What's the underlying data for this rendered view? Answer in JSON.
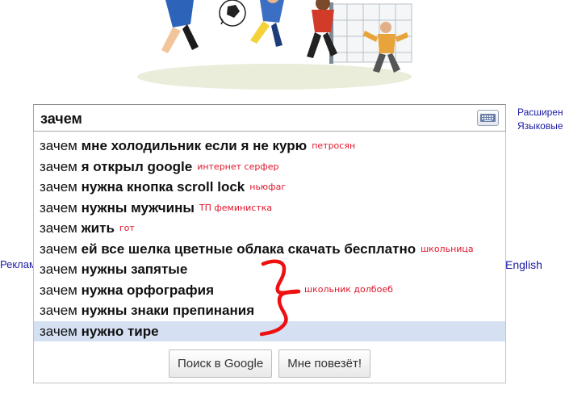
{
  "search": {
    "value": "зачем"
  },
  "suggestions": [
    {
      "prefix": "зачем",
      "completion": "мне холодильник если я не курю",
      "note": "петросян"
    },
    {
      "prefix": "зачем",
      "completion": "я открыл google",
      "note": "интернет серфер"
    },
    {
      "prefix": "зачем",
      "completion": "нужна кнопка scroll lock",
      "note": "ньюфаг"
    },
    {
      "prefix": "зачем",
      "completion": "нужны мужчины",
      "note": "ТП феминистка"
    },
    {
      "prefix": "зачем",
      "completion": "жить",
      "note": "гот"
    },
    {
      "prefix": "зачем",
      "completion": "ей все шелка цветные облака скачать бесплатно",
      "note": "школьница"
    },
    {
      "prefix": "зачем",
      "completion": "нужны запятые",
      "note": ""
    },
    {
      "prefix": "зачем",
      "completion": "нужна орфография",
      "note": ""
    },
    {
      "prefix": "зачем",
      "completion": "нужны знаки препинания",
      "note": ""
    },
    {
      "prefix": "зачем",
      "completion": "нужно тире",
      "note": "",
      "selected": true
    }
  ],
  "group_note": "школьник долбоеб",
  "buttons": {
    "search": "Поиск в Google",
    "lucky": "Мне повезёт!"
  },
  "side_links": {
    "advanced": "Расширен",
    "language": "Языковые",
    "ads": "Реклам",
    "english": "English"
  },
  "colors": {
    "link": "#1a1aa6",
    "annotation": "#e0162b",
    "selected_row": "#d5e1f2"
  }
}
